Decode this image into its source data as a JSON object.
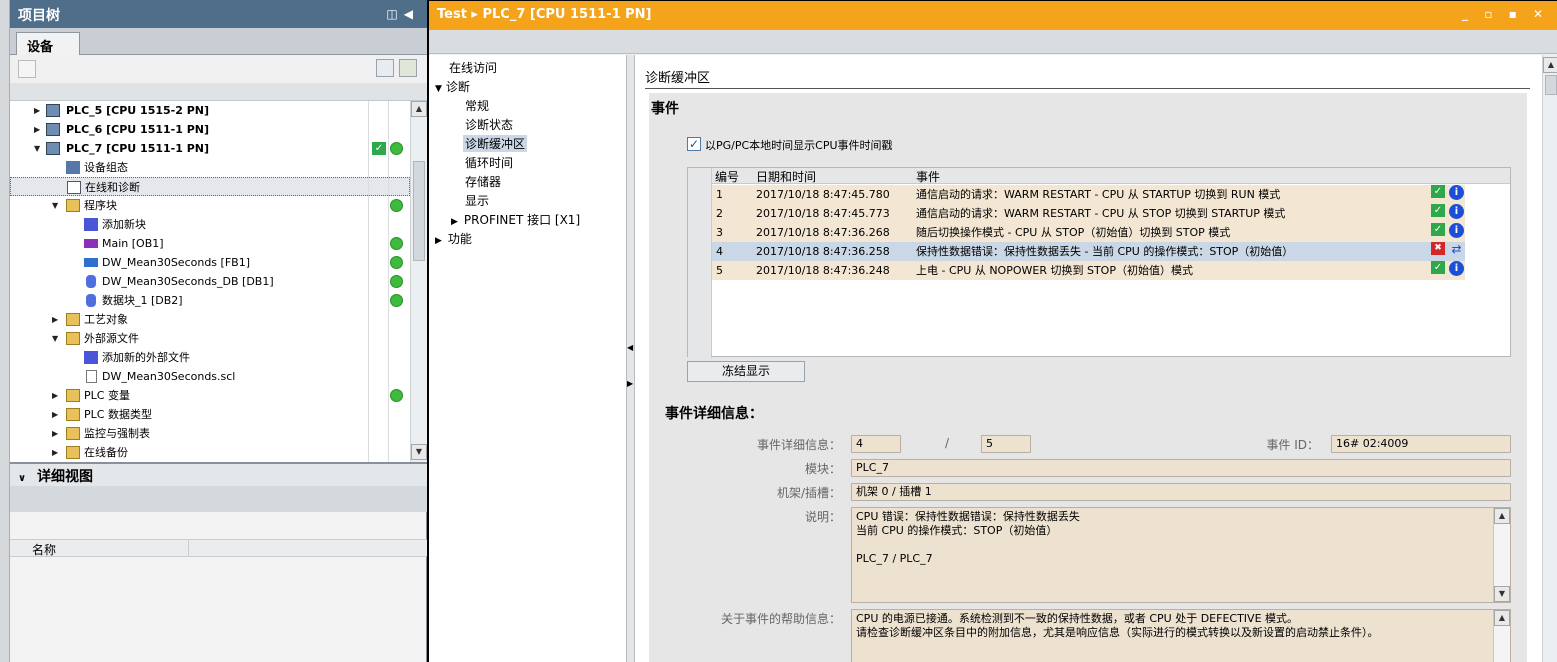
{
  "project_tree": {
    "title": "项目树",
    "tab": "设备",
    "items": [
      {
        "label": "PLC_5 [CPU 1515-2 PN]",
        "bold": true
      },
      {
        "label": "PLC_6 [CPU 1511-1 PN]",
        "bold": true
      },
      {
        "label": "PLC_7 [CPU 1511-1 PN]",
        "bold": true
      },
      {
        "label": "设备组态"
      },
      {
        "label": "在线和诊断"
      },
      {
        "label": "程序块"
      },
      {
        "label": "添加新块"
      },
      {
        "label": "Main [OB1]"
      },
      {
        "label": "DW_Mean30Seconds [FB1]"
      },
      {
        "label": "DW_Mean30Seconds_DB [DB1]"
      },
      {
        "label": "数据块_1 [DB2]"
      },
      {
        "label": "工艺对象"
      },
      {
        "label": "外部源文件"
      },
      {
        "label": "添加新的外部文件"
      },
      {
        "label": "DW_Mean30Seconds.scl"
      },
      {
        "label": "PLC 变量"
      },
      {
        "label": "PLC 数据类型"
      },
      {
        "label": "监控与强制表"
      },
      {
        "label": "在线备份"
      }
    ]
  },
  "detail_view": {
    "title": "详细视图",
    "column_name": "名称"
  },
  "window": {
    "title": "Test ▸ PLC_7 [CPU 1511-1 PN]",
    "controls": "_ ▫ ▪ ✕"
  },
  "nav": {
    "items": [
      {
        "label": "在线访问"
      },
      {
        "label": "诊断"
      },
      {
        "label": "常规"
      },
      {
        "label": "诊断状态"
      },
      {
        "label": "诊断缓冲区"
      },
      {
        "label": "循环时间"
      },
      {
        "label": "存储器"
      },
      {
        "label": "显示"
      },
      {
        "label": "PROFINET 接口 [X1]"
      },
      {
        "label": "功能"
      }
    ]
  },
  "diag_buffer": {
    "section_title": "诊断缓冲区",
    "events_title": "事件",
    "checkbox_label": "以PG/PC本地时间显示CPU事件时间戳",
    "columns": [
      "编号",
      "日期和时间",
      "事件"
    ],
    "rows": [
      {
        "no": "1",
        "datetime": "2017/10/18 8:47:45.780",
        "event": "通信启动的请求：WARM RESTART - CPU 从 STARTUP 切换到 RUN 模式",
        "status": "ok"
      },
      {
        "no": "2",
        "datetime": "2017/10/18 8:47:45.773",
        "event": "通信启动的请求：WARM RESTART - CPU 从 STOP 切换到 STARTUP 模式",
        "status": "ok"
      },
      {
        "no": "3",
        "datetime": "2017/10/18 8:47:36.268",
        "event": "随后切换操作模式 - CPU 从 STOP（初始值）切换到 STOP 模式",
        "status": "ok"
      },
      {
        "no": "4",
        "datetime": "2017/10/18 8:47:36.258",
        "event": "保持性数据错误：保持性数据丢失 - 当前 CPU 的操作模式：STOP（初始值）",
        "status": "error"
      },
      {
        "no": "5",
        "datetime": "2017/10/18 8:47:36.248",
        "event": "上电 - CPU 从 NOPOWER 切换到 STOP（初始值）模式",
        "status": "ok"
      }
    ],
    "freeze_button": "冻结显示"
  },
  "event_details": {
    "title": "事件详细信息：",
    "detail_label": "事件详细信息：",
    "detail_index": "4",
    "separator": "/",
    "detail_total": "5",
    "event_id_label": "事件 ID：",
    "event_id": "16# 02:4009",
    "module_label": "模块：",
    "module": "PLC_7",
    "rack_label": "机架/插槽：",
    "rack": "机架 0 / 插槽 1",
    "desc_label": "说明：",
    "description": "CPU 错误：保持性数据错误：保持性数据丢失\n当前 CPU 的操作模式：STOP（初始值）\n\nPLC_7 / PLC_7",
    "help_label": "关于事件的帮助信息：",
    "help": "CPU 的电源已接通。系统检测到不一致的保持性数据，或者 CPU 处于 DEFECTIVE 模式。\n请检查诊断缓冲区条目中的附加信息，尤其是响应信息（实际进行的模式转换以及新设置的启动禁止条件）。"
  },
  "colors": {
    "title_orange": "#f5a31a",
    "tree_title": "#4e6e89",
    "ok_green": "#2ea84a",
    "error_red": "#d42828",
    "info_blue": "#1c4fd6",
    "selected_row": "#c9d7e6",
    "row_tan": "#f3e7d4"
  }
}
